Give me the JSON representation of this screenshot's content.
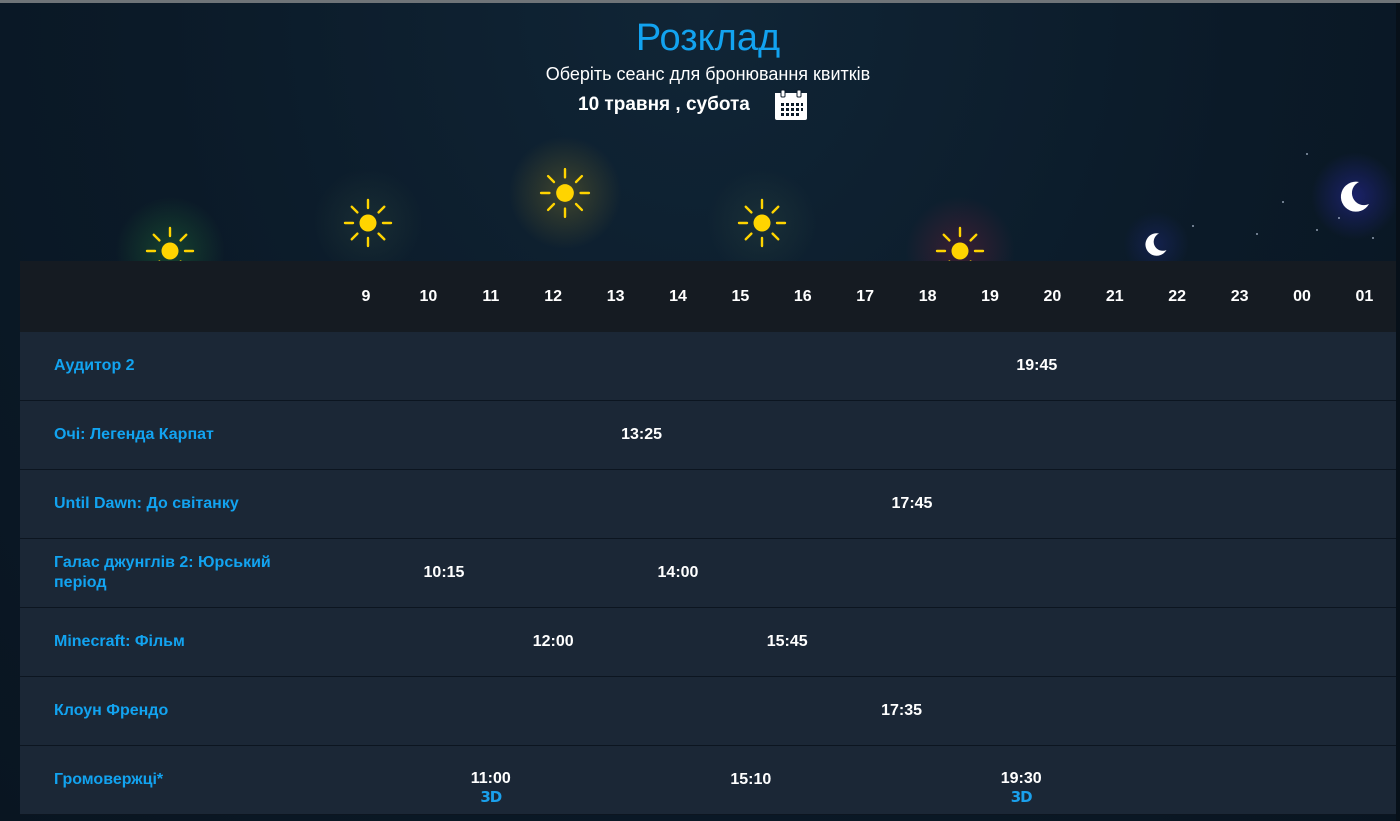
{
  "header": {
    "title": "Розклад",
    "subtitle": "Оберіть сеанс для бронювання квитків",
    "date": "10 травня , субота",
    "calendar_icon": "calendar-icon"
  },
  "colors": {
    "accent": "#12a3f0",
    "row_bg": "#1b2736",
    "header_bg": "#151b22",
    "sun": "#ffd400",
    "moon": "#ffffff"
  },
  "hours": [
    "9",
    "10",
    "11",
    "12",
    "13",
    "14",
    "15",
    "16",
    "17",
    "18",
    "19",
    "20",
    "21",
    "22",
    "23",
    "00",
    "01"
  ],
  "films": [
    {
      "title": "Аудитор 2",
      "sessions": [
        {
          "time": "19:45"
        }
      ]
    },
    {
      "title": "Очі: Легенда Карпат",
      "sessions": [
        {
          "time": "13:25"
        }
      ]
    },
    {
      "title": "Until Dawn: До світанку",
      "sessions": [
        {
          "time": "17:45"
        }
      ]
    },
    {
      "title": "Галас джунглів 2: Юрський період",
      "sessions": [
        {
          "time": "10:15"
        },
        {
          "time": "14:00"
        }
      ]
    },
    {
      "title": "Minecraft: Фільм",
      "sessions": [
        {
          "time": "12:00"
        },
        {
          "time": "15:45"
        }
      ]
    },
    {
      "title": "Клоун Френдо",
      "sessions": [
        {
          "time": "17:35"
        }
      ]
    },
    {
      "title": "Громовержці*",
      "sessions": [
        {
          "time": "11:00",
          "format": "3D"
        },
        {
          "time": "15:10"
        },
        {
          "time": "19:30",
          "format": "3D"
        }
      ]
    }
  ]
}
